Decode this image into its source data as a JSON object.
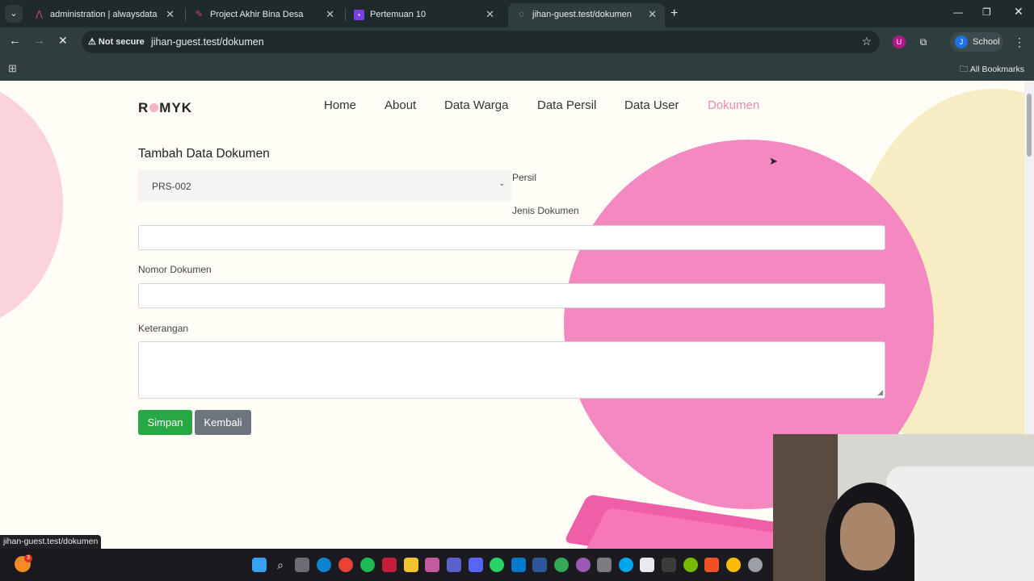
{
  "browser": {
    "tabs": [
      {
        "label": "administration | alwaysdata",
        "active": false
      },
      {
        "label": "Project Akhir Bina Desa",
        "active": false
      },
      {
        "label": "Pertemuan 10",
        "active": false
      },
      {
        "label": "jihan-guest.test/dokumen",
        "active": true
      }
    ],
    "security_label": "Not secure",
    "url": "jihan-guest.test/dokumen",
    "profile_initial": "J",
    "profile_label": "School",
    "bookmarks_label": "All Bookmarks",
    "status_url": "jihan-guest.test/dokumen"
  },
  "site": {
    "logo_left": "R",
    "logo_right": "MYK",
    "nav": [
      "Home",
      "About",
      "Data Warga",
      "Data Persil",
      "Data User",
      "Dokumen"
    ],
    "active_nav": "Dokumen"
  },
  "form": {
    "title": "Tambah Data Dokumen",
    "persil_select_value": "PRS-002",
    "persil_label": "Persil",
    "jenis_label": "Jenis Dokumen",
    "jenis_value": "",
    "nomor_label": "Nomor Dokumen",
    "nomor_value": "",
    "keterangan_label": "Keterangan",
    "keterangan_value": "",
    "save_label": "Simpan",
    "back_label": "Kembali"
  },
  "taskbar": {
    "weather_badge": "3"
  },
  "colors": {
    "accent_pink": "#f488c1",
    "save_green": "#28a745",
    "back_gray": "#6c757d"
  }
}
